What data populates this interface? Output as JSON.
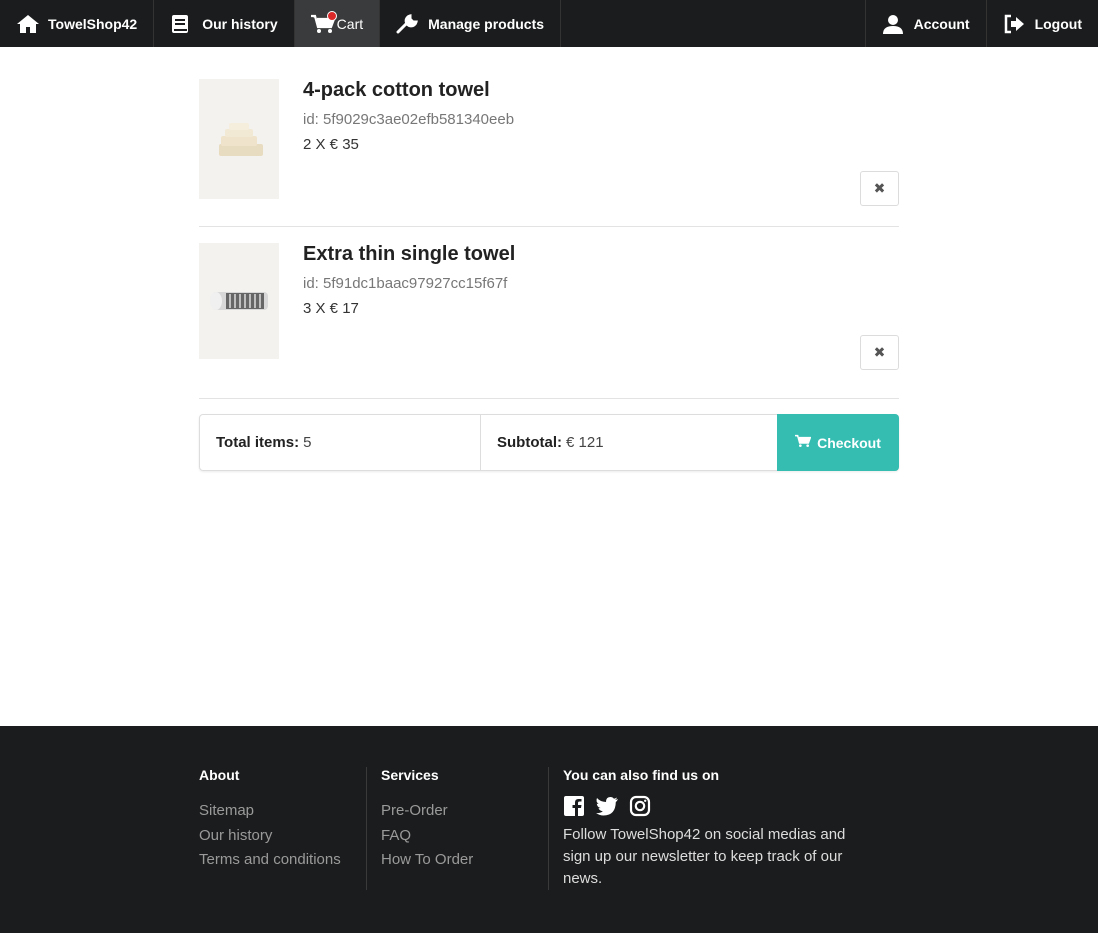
{
  "nav": {
    "brand": "TowelShop42",
    "history": "Our history",
    "cart": "Cart",
    "manage": "Manage products",
    "account": "Account",
    "logout": "Logout"
  },
  "cart": {
    "items": [
      {
        "title": "4-pack cotton towel",
        "id": "id: 5f9029c3ae02efb581340eeb",
        "qty": "2 X € 35"
      },
      {
        "title": "Extra thin single towel",
        "id": "id: 5f91dc1baac97927cc15f67f",
        "qty": "3 X € 17"
      }
    ]
  },
  "summary": {
    "items_label": "Total items:",
    "items_value": "5",
    "subtotal_label": "Subtotal:",
    "subtotal_value": "€ 121",
    "checkout": "Checkout"
  },
  "footer": {
    "about": {
      "heading": "About",
      "links": [
        "Sitemap",
        "Our history",
        "Terms and conditions"
      ]
    },
    "services": {
      "heading": "Services",
      "links": [
        "Pre-Order",
        "FAQ",
        "How To Order"
      ]
    },
    "social": {
      "heading": "You can also find us on",
      "text": "Follow TowelShop42 on social medias and sign up our newsletter to keep track of our news.",
      "icons": [
        "facebook-icon",
        "twitter-icon",
        "instagram-icon"
      ]
    }
  },
  "colors": {
    "nav_bg": "#1b1c1d",
    "accent": "#35bdb2",
    "badge": "#db2828"
  }
}
